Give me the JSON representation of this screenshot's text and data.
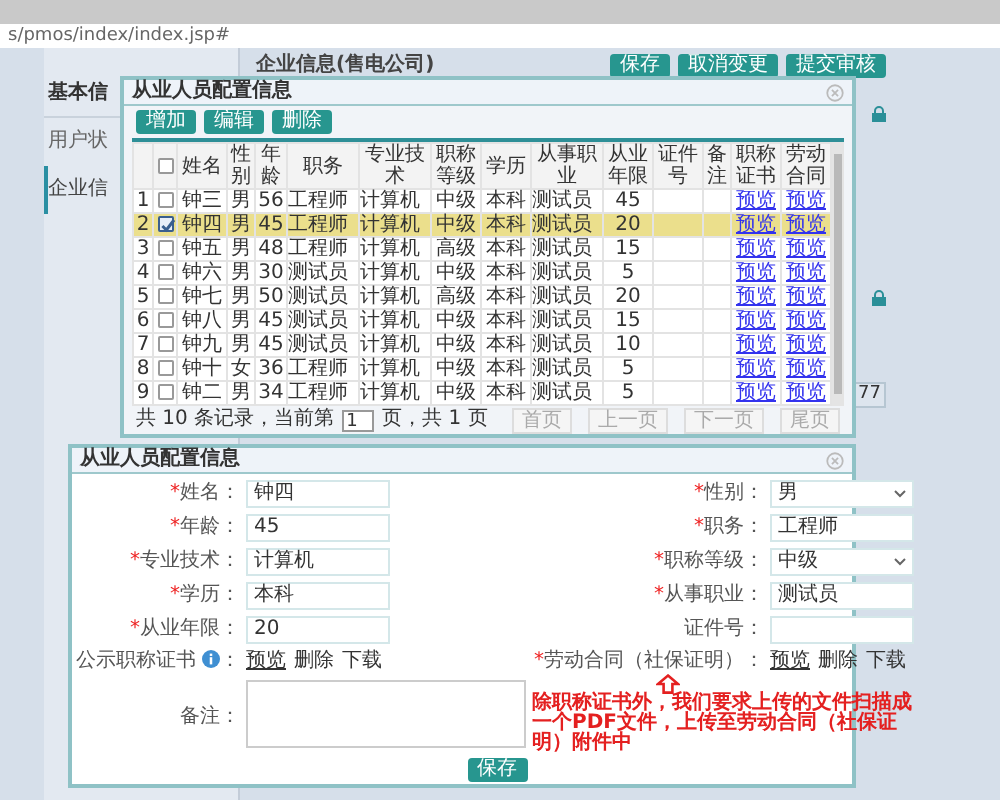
{
  "address_bar": {
    "url": "s/pmos/index/index.jsp#"
  },
  "sidebar": {
    "title": "基本信",
    "items": [
      {
        "label": "用户状",
        "selected": false
      },
      {
        "label": "企业信",
        "selected": true
      }
    ]
  },
  "main": {
    "title": "企业信息(售电公司)",
    "buttons": [
      "保存",
      "取消变更",
      "提交审核"
    ],
    "field_value": "77"
  },
  "list_dialog": {
    "title": "从业人员配置信息",
    "toolbar": [
      "增加",
      "编辑",
      "删除"
    ],
    "columns": [
      "姓名",
      "性别",
      "年龄",
      "职务",
      "专业技术",
      "职称等级",
      "学历",
      "从事职业",
      "从业年限",
      "证件号",
      "备注",
      "职称证书",
      "劳动合同"
    ],
    "header_checked": false,
    "rows": [
      {
        "index": "1",
        "checked": false,
        "selected": false,
        "name": "钟三",
        "gender": "男",
        "age": "56",
        "position": "工程师",
        "specialty": "计算机",
        "title_level": "中级",
        "education": "本科",
        "occupation": "测试员",
        "years": "45",
        "certificate": "预览",
        "contract": "预览"
      },
      {
        "index": "2",
        "checked": true,
        "selected": true,
        "name": "钟四",
        "gender": "男",
        "age": "45",
        "position": "工程师",
        "specialty": "计算机",
        "title_level": "中级",
        "education": "本科",
        "occupation": "测试员",
        "years": "20",
        "certificate": "预览",
        "contract": "预览"
      },
      {
        "index": "3",
        "checked": false,
        "selected": false,
        "name": "钟五",
        "gender": "男",
        "age": "48",
        "position": "工程师",
        "specialty": "计算机",
        "title_level": "高级",
        "education": "本科",
        "occupation": "测试员",
        "years": "15",
        "certificate": "预览",
        "contract": "预览"
      },
      {
        "index": "4",
        "checked": false,
        "selected": false,
        "name": "钟六",
        "gender": "男",
        "age": "30",
        "position": "测试员",
        "specialty": "计算机",
        "title_level": "中级",
        "education": "本科",
        "occupation": "测试员",
        "years": "5",
        "certificate": "预览",
        "contract": "预览"
      },
      {
        "index": "5",
        "checked": false,
        "selected": false,
        "name": "钟七",
        "gender": "男",
        "age": "50",
        "position": "测试员",
        "specialty": "计算机",
        "title_level": "高级",
        "education": "本科",
        "occupation": "测试员",
        "years": "20",
        "certificate": "预览",
        "contract": "预览"
      },
      {
        "index": "6",
        "checked": false,
        "selected": false,
        "name": "钟八",
        "gender": "男",
        "age": "45",
        "position": "测试员",
        "specialty": "计算机",
        "title_level": "中级",
        "education": "本科",
        "occupation": "测试员",
        "years": "15",
        "certificate": "预览",
        "contract": "预览"
      },
      {
        "index": "7",
        "checked": false,
        "selected": false,
        "name": "钟九",
        "gender": "男",
        "age": "45",
        "position": "测试员",
        "specialty": "计算机",
        "title_level": "中级",
        "education": "本科",
        "occupation": "测试员",
        "years": "10",
        "certificate": "预览",
        "contract": "预览"
      },
      {
        "index": "8",
        "checked": false,
        "selected": false,
        "name": "钟十",
        "gender": "女",
        "age": "36",
        "position": "工程师",
        "specialty": "计算机",
        "title_level": "中级",
        "education": "本科",
        "occupation": "测试员",
        "years": "5",
        "certificate": "预览",
        "contract": "预览"
      },
      {
        "index": "9",
        "checked": false,
        "selected": false,
        "name": "钟二",
        "gender": "男",
        "age": "34",
        "position": "工程师",
        "specialty": "计算机",
        "title_level": "中级",
        "education": "本科",
        "occupation": "测试员",
        "years": "5",
        "certificate": "预览",
        "contract": "预览"
      }
    ],
    "pagination": {
      "before": "共 10 条记录，当前第",
      "page": "1",
      "after": "页，共 1 页",
      "buttons": [
        {
          "label": "首页",
          "disabled": true
        },
        {
          "label": "上一页",
          "disabled": true
        },
        {
          "label": "下一页",
          "disabled": true
        },
        {
          "label": "尾页",
          "disabled": true
        }
      ]
    }
  },
  "form_dialog": {
    "title": "从业人员配置信息",
    "fields": [
      {
        "required_mark": "*",
        "label": "姓名：",
        "kind": "text",
        "value": "钟四"
      },
      {
        "required_mark": "*",
        "label": "性别：",
        "kind": "select",
        "value": "男"
      },
      {
        "required_mark": "*",
        "label": "年龄：",
        "kind": "text",
        "value": "45"
      },
      {
        "required_mark": "*",
        "label": "职务：",
        "kind": "text",
        "value": "工程师"
      },
      {
        "required_mark": "*",
        "label": "专业技术：",
        "kind": "text",
        "value": "计算机"
      },
      {
        "required_mark": "*",
        "label": "职称等级：",
        "kind": "select",
        "value": "中级"
      },
      {
        "required_mark": "*",
        "label": "学历：",
        "kind": "text",
        "value": "本科"
      },
      {
        "required_mark": "*",
        "label": "从事职业：",
        "kind": "text",
        "value": "测试员"
      },
      {
        "required_mark": "*",
        "label": "从业年限：",
        "kind": "text",
        "value": "20"
      },
      {
        "label": "证件号：",
        "kind": "text"
      }
    ],
    "attachments": [
      {
        "label": "公示职称证书",
        "info_icon": true,
        "suffix": "：",
        "actions": [
          "预览",
          "删除",
          "下载"
        ]
      },
      {
        "required_mark": "*",
        "label": "劳动合同（社保证明）",
        "info_icon": false,
        "suffix": "：",
        "actions": [
          "预览",
          "删除",
          "下载"
        ]
      }
    ],
    "remark_label": "备注：",
    "annotation": "除职称证书外，我们要求上传的文件扫描成一个PDF文件，上传至劳动合同（社保证明）附件中",
    "save": "保存"
  }
}
